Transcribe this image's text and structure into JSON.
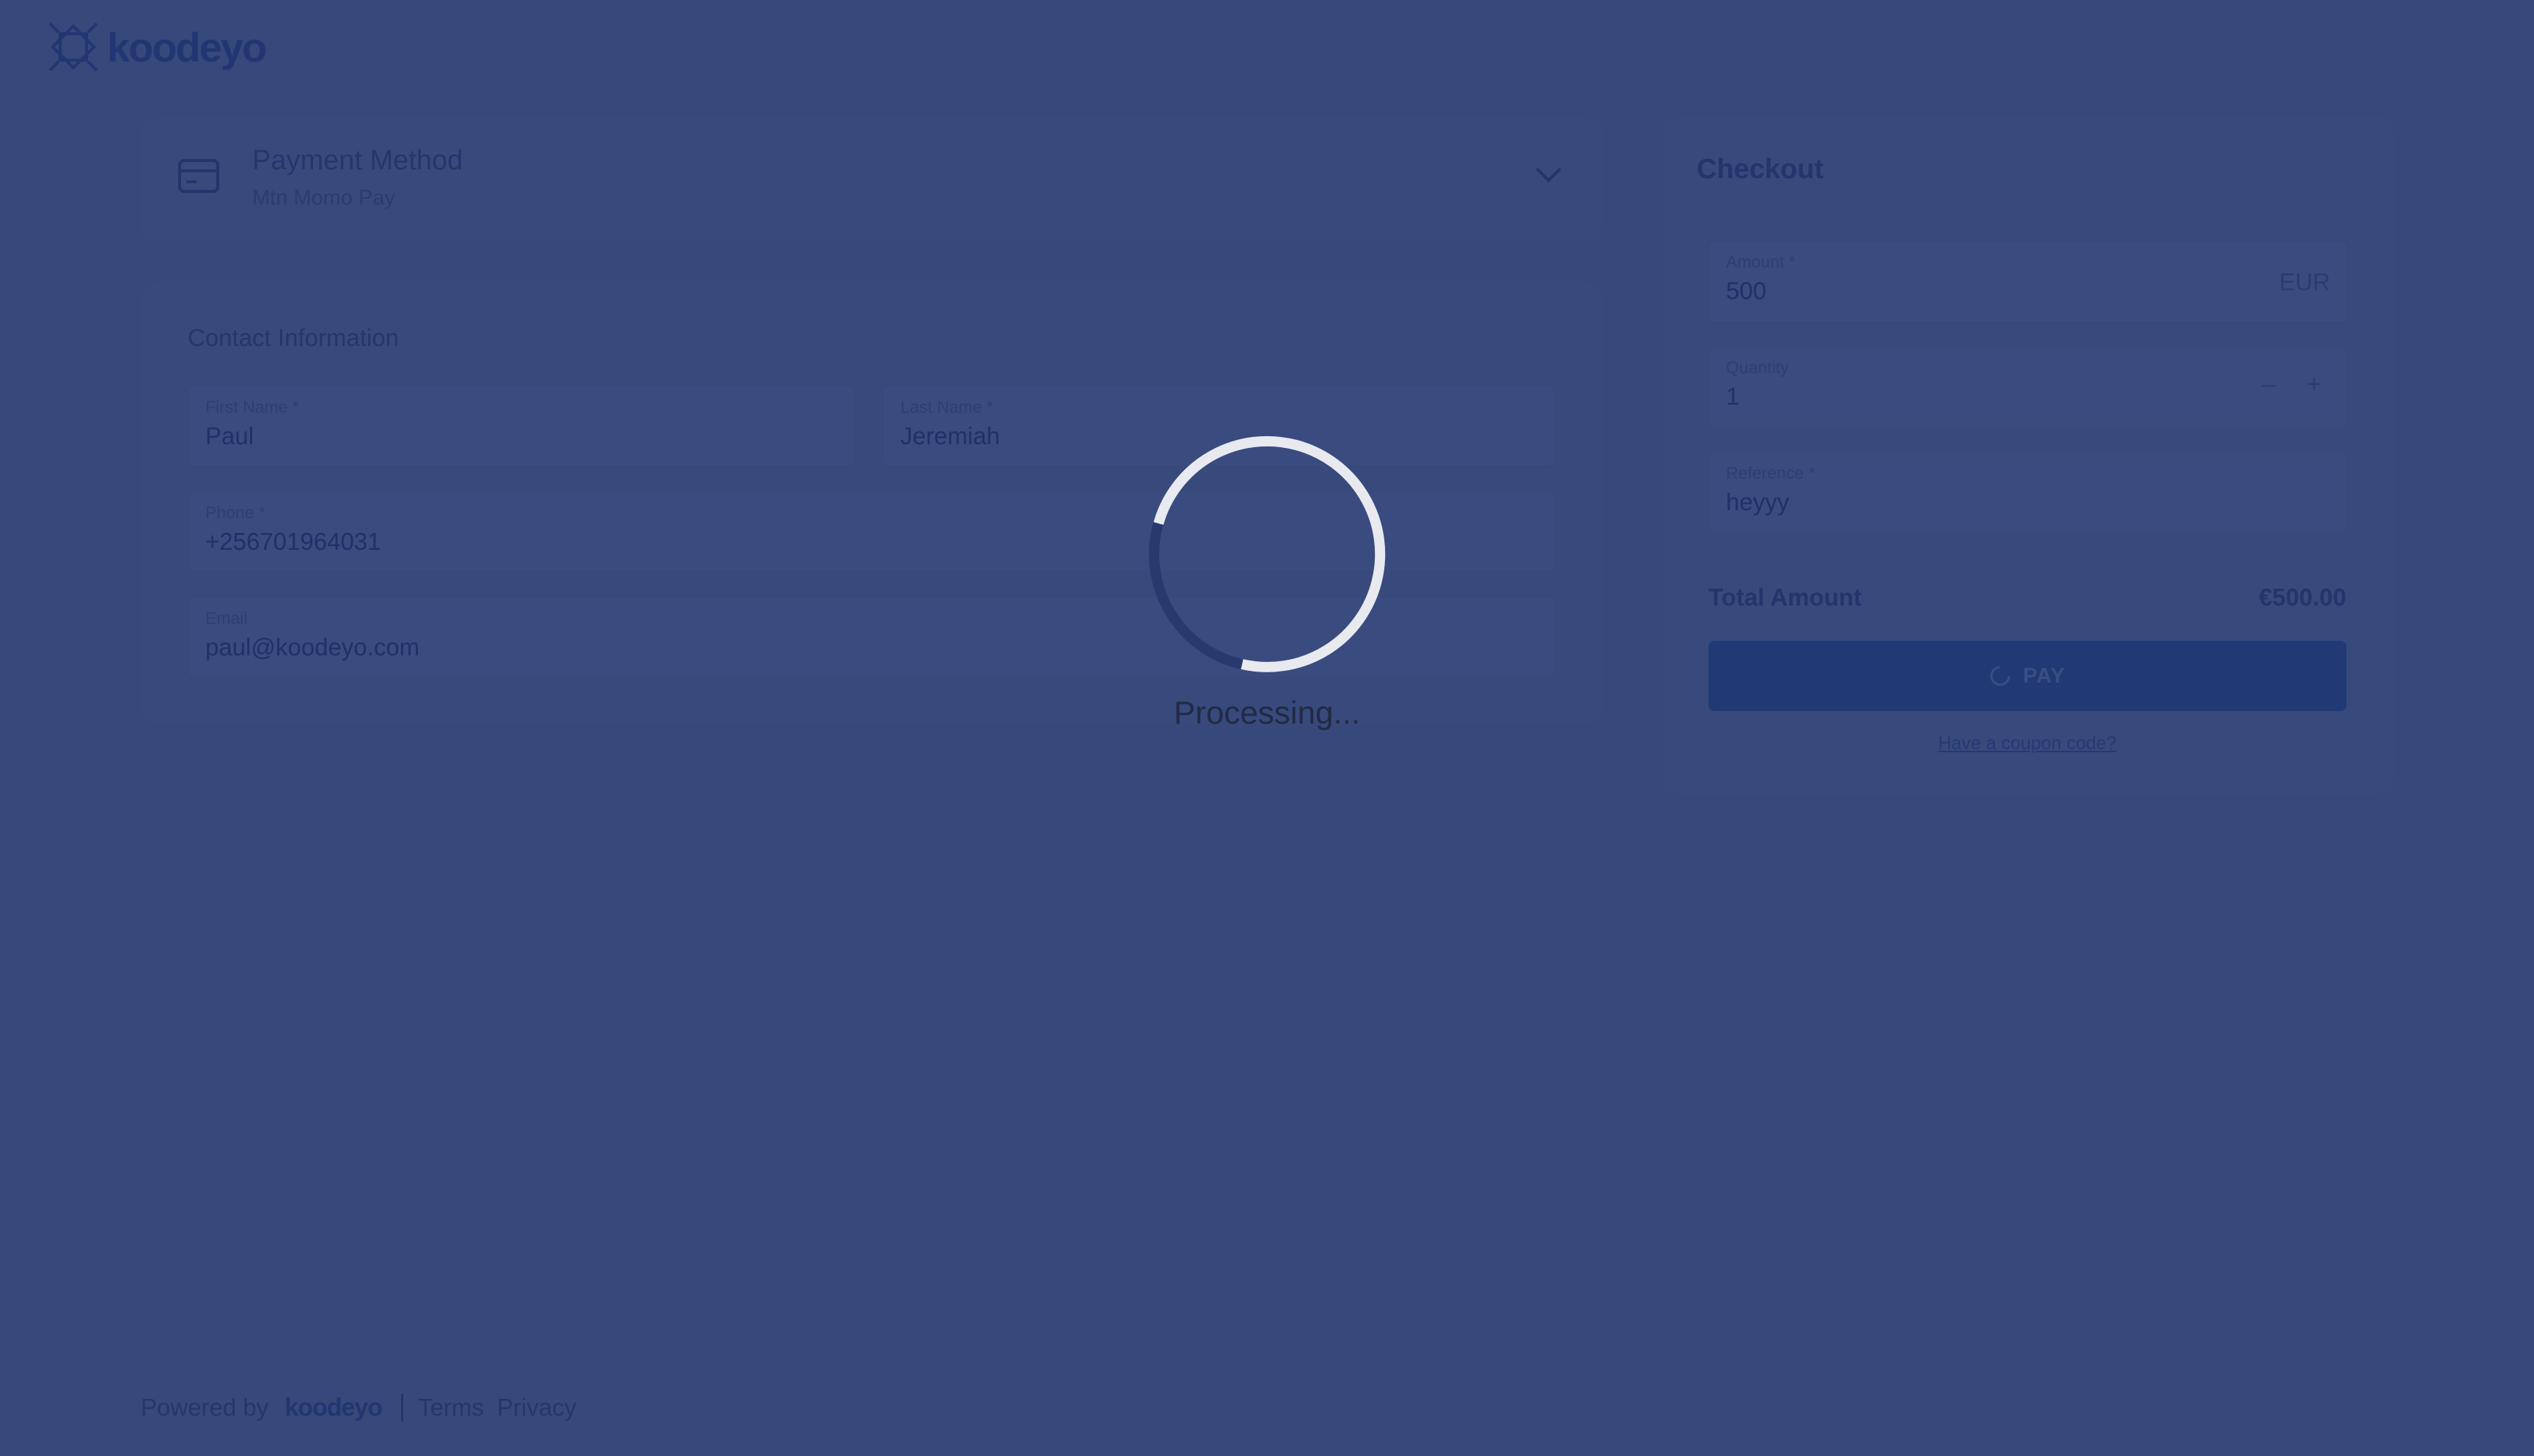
{
  "brand": {
    "name": "koodeyo",
    "color": "#213672"
  },
  "payment_method": {
    "title": "Payment Method",
    "selected": "Mtn Momo Pay",
    "icon": "credit-card-icon"
  },
  "contact": {
    "title": "Contact Information",
    "first_name": {
      "label": "First Name *",
      "value": "Paul"
    },
    "last_name": {
      "label": "Last Name *",
      "value": "Jeremiah"
    },
    "phone": {
      "label": "Phone *",
      "value": "+256701964031"
    },
    "email": {
      "label": "Email",
      "value": "paul@koodeyo.com"
    }
  },
  "checkout": {
    "title": "Checkout",
    "amount": {
      "label": "Amount *",
      "value": "500",
      "currency": "EUR"
    },
    "quantity": {
      "label": "Quantity",
      "value": "1",
      "minus": "–",
      "plus": "+"
    },
    "reference": {
      "label": "Reference *",
      "value": "heyyy"
    },
    "total_label": "Total Amount",
    "total_value": "€500.00",
    "pay_label": "PAY",
    "coupon_link": "Have a coupon code?"
  },
  "overlay": {
    "status": "Processing..."
  },
  "footer": {
    "powered_by": "Powered by",
    "brand": "koodeyo",
    "terms": "Terms",
    "privacy": "Privacy"
  },
  "colors": {
    "background": "#36497a",
    "overlay_spinner": "#e8eaf0",
    "pay_button": "#213a75"
  }
}
